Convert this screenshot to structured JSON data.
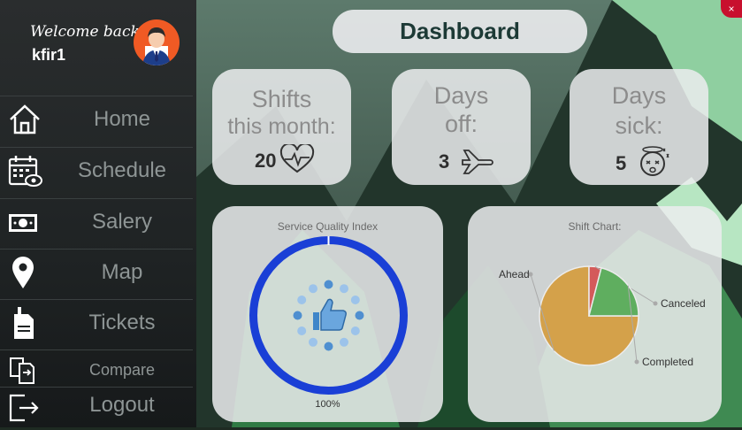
{
  "window": {
    "close_glyph": "×"
  },
  "user": {
    "welcome": "Welcome back,",
    "name": "kfir1"
  },
  "nav": [
    {
      "label": "Home",
      "icon": "home-icon"
    },
    {
      "label": "Schedule",
      "icon": "calendar-eye-icon"
    },
    {
      "label": "Salery",
      "icon": "money-icon"
    },
    {
      "label": "Map",
      "icon": "map-pin-icon"
    },
    {
      "label": "Tickets",
      "icon": "ticket-icon"
    },
    {
      "label": "Compare",
      "icon": "compare-icon"
    },
    {
      "label": "Logout",
      "icon": "logout-icon"
    }
  ],
  "header": {
    "title": "Dashboard"
  },
  "stats": {
    "shifts": {
      "line1": "Shifts",
      "line2": "this month:",
      "value": "20",
      "icon": "heartbeat-icon"
    },
    "days_off": {
      "line1": "Days",
      "line2": "off:",
      "value": "3",
      "icon": "airplane-icon"
    },
    "days_sick": {
      "line1": "Days",
      "line2": "sick:",
      "value": "5",
      "icon": "sick-face-icon"
    }
  },
  "quality": {
    "title": "Service Quality Index",
    "value_label": "100%",
    "value": 1.0,
    "ring_color": "#1a3fd6",
    "icon": "thumbs-up-icon"
  },
  "chart_data": {
    "type": "pie",
    "title": "Shift Chart:",
    "categories": [
      "Ahead",
      "Canceled",
      "Completed"
    ],
    "values": [
      75,
      4,
      21
    ],
    "colors": [
      "#d4a14a",
      "#d45a5a",
      "#5fae5f"
    ]
  }
}
